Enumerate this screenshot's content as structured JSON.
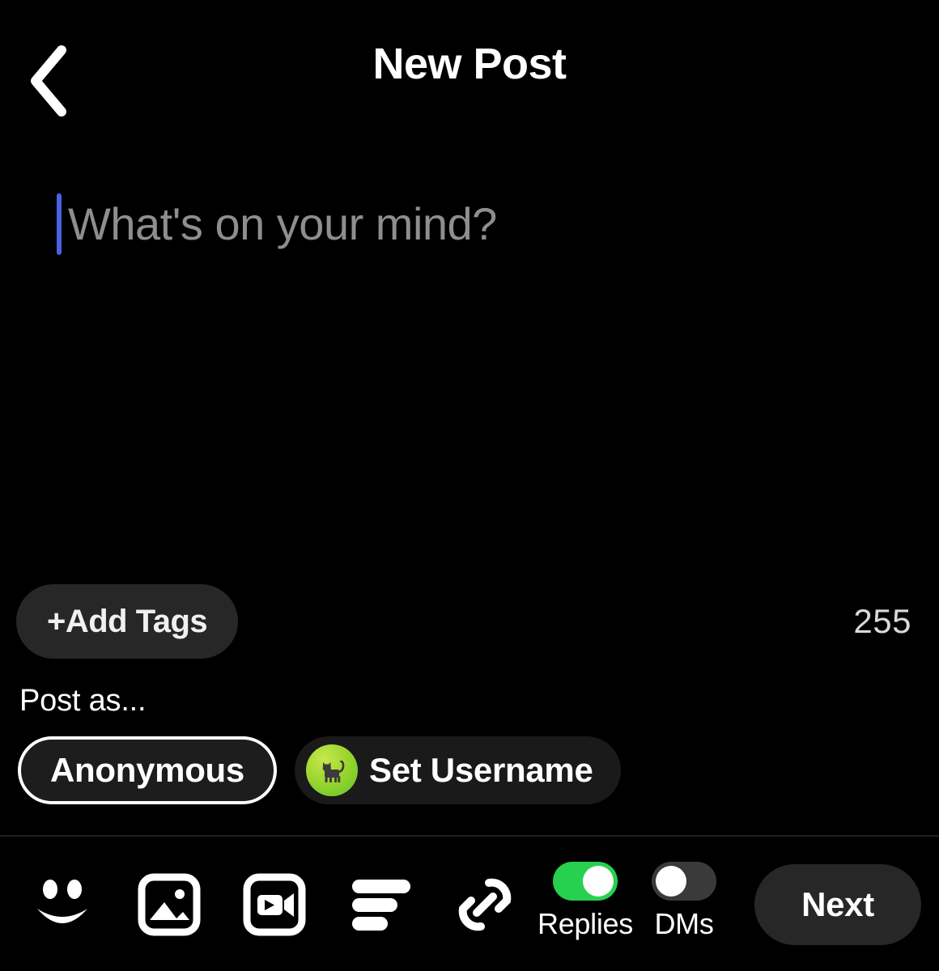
{
  "header": {
    "title": "New Post",
    "back_icon": "chevron-left-icon"
  },
  "composer": {
    "placeholder": "What's on your mind?",
    "value": "",
    "caret_color": "#4763e4"
  },
  "tags": {
    "add_tags_label": "+Add Tags",
    "char_count": "255"
  },
  "post_as": {
    "label": "Post as...",
    "options": [
      {
        "label": "Anonymous",
        "selected": true
      },
      {
        "label": "Set Username",
        "selected": false,
        "avatar_icon": "cat-avatar-icon"
      }
    ]
  },
  "toolbar": {
    "icons": [
      {
        "name": "emoji-smiley-icon"
      },
      {
        "name": "image-icon"
      },
      {
        "name": "video-icon"
      },
      {
        "name": "poll-icon"
      },
      {
        "name": "link-icon"
      }
    ],
    "toggles": [
      {
        "label": "Replies",
        "state": "on",
        "color": "#27d14f"
      },
      {
        "label": "DMs",
        "state": "off",
        "color": "#3a3a3a"
      }
    ],
    "next_label": "Next"
  }
}
